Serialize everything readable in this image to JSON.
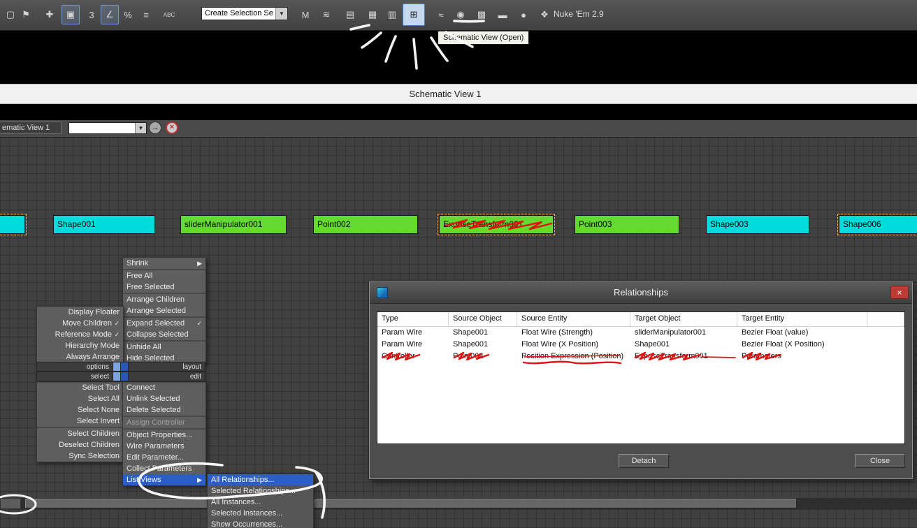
{
  "glyphs": {
    "submenu_arrow": "▶",
    "check": "✓",
    "dropdown_arrow": "▼",
    "find_arrow": "→",
    "cancel_x": "×",
    "close_x": "×"
  },
  "colors": {
    "node_shape": "#00dcdc",
    "node_helper": "#63d932",
    "menu_highlight": "#2d5ec6",
    "toolbar_highlight_border": "#4d7fc0",
    "annotation_white": "#ffffff",
    "annotation_red": "#e01212"
  },
  "toolbar": {
    "icons": [
      {
        "name": "new-scene-icon",
        "glyph": "▢"
      },
      {
        "name": "select-and-place-icon",
        "glyph": "⚑"
      },
      {
        "name": "select-and-move-icon",
        "glyph": "✚"
      },
      {
        "name": "select-and-manipulate-icon",
        "glyph": "▣"
      },
      {
        "name": "angle-snap-icon",
        "glyph": "3"
      },
      {
        "name": "snaps-toggle-icon",
        "glyph": "∠"
      },
      {
        "name": "percent-snap-icon",
        "glyph": "%"
      },
      {
        "name": "spinner-snap-icon",
        "glyph": "≡"
      },
      {
        "name": "named-selection-sets-icon",
        "glyph": "ABC"
      },
      {
        "name": "mirror-icon",
        "glyph": "M"
      },
      {
        "name": "align-icon",
        "glyph": "≋"
      },
      {
        "name": "layer-manager-icon",
        "glyph": "▤"
      },
      {
        "name": "graphite-ribbon-icon",
        "glyph": "▦"
      },
      {
        "name": "scene-explorer-icon",
        "glyph": "▥"
      },
      {
        "name": "schematic-view-icon",
        "glyph": "⊞"
      },
      {
        "name": "curve-editor-icon",
        "glyph": "≈"
      },
      {
        "name": "material-editor-icon",
        "glyph": "◉"
      },
      {
        "name": "render-setup-icon",
        "glyph": "▩"
      },
      {
        "name": "rendered-frame-icon",
        "glyph": "▬"
      },
      {
        "name": "render-production-icon",
        "glyph": "●"
      },
      {
        "name": "nukem-plugin-icon",
        "glyph": "❖"
      }
    ],
    "selection_set_value": "Create Selection Se",
    "plugin_label": "Nuke 'Em 2.9",
    "tooltip": "Schematic View (Open)"
  },
  "window": {
    "title": "Schematic View 1"
  },
  "sv_toolbar": {
    "view_label": "ematic View 1",
    "search_value": ""
  },
  "canvas": {
    "nodes": [
      {
        "label": "",
        "type": "shape",
        "selected": true
      },
      {
        "label": "Shape001",
        "type": "shape",
        "selected": false
      },
      {
        "label": "sliderManipulator001",
        "type": "helper",
        "selected": false
      },
      {
        "label": "Point002",
        "type": "helper",
        "selected": false
      },
      {
        "label": "ExposeTransform001",
        "type": "helper",
        "selected": true
      },
      {
        "label": "Point003",
        "type": "helper",
        "selected": false
      },
      {
        "label": "Shape003",
        "type": "shape",
        "selected": false
      },
      {
        "label": "Shape006",
        "type": "shape",
        "selected": true
      }
    ]
  },
  "quad_menu": {
    "layout_items": [
      {
        "label": "Shrink",
        "arrow": true
      },
      {
        "label": "Free All"
      },
      {
        "label": "Free Selected"
      },
      {
        "label": "Arrange Children"
      },
      {
        "label": "Arrange Selected"
      },
      {
        "label": "Expand Selected",
        "checked": true
      },
      {
        "label": "Collapse Selected"
      },
      {
        "label": "Unhide All"
      },
      {
        "label": "Hide Selected"
      }
    ],
    "options_items": [
      {
        "label": "Display Floater"
      },
      {
        "label": "Move Children",
        "checked": true
      },
      {
        "label": "Reference Mode",
        "checked": true
      },
      {
        "label": "Hierarchy Mode"
      },
      {
        "label": "Always Arrange"
      }
    ],
    "headers": [
      {
        "left": "options",
        "right": "layout"
      },
      {
        "left": "select",
        "right": "edit"
      }
    ],
    "select_items": [
      {
        "label": "Select Tool"
      },
      {
        "label": "Select All"
      },
      {
        "label": "Select None"
      },
      {
        "label": "Select Invert"
      },
      {
        "label": "Select Children"
      },
      {
        "label": "Deselect Children"
      },
      {
        "label": "Sync Selection"
      }
    ],
    "edit_items": [
      {
        "label": "Connect"
      },
      {
        "label": "Unlink Selected"
      },
      {
        "label": "Delete Selected"
      },
      {
        "label": "Assign Controller",
        "disabled": true
      },
      {
        "label": "Object Properties..."
      },
      {
        "label": "Wire Parameters"
      },
      {
        "label": "Edit Parameter..."
      },
      {
        "label": "Collect Parameters"
      },
      {
        "label": "List Views",
        "arrow": true,
        "highlighted": true
      }
    ],
    "list_views_submenu": [
      {
        "label": "All Relationships...",
        "highlighted": true
      },
      {
        "label": "Selected Relationships..."
      },
      {
        "label": "All Instances..."
      },
      {
        "label": "Selected Instances..."
      },
      {
        "label": "Show Occurrences..."
      }
    ]
  },
  "relationships_dialog": {
    "title": "Relationships",
    "columns": [
      "Type",
      "Source Object",
      "Source Entity",
      "Target Object",
      "Target Entity"
    ],
    "rows": [
      [
        "Param Wire",
        "Shape001",
        "Float Wire (Strength)",
        "sliderManipulator001",
        "Bezier Float (value)"
      ],
      [
        "Param Wire",
        "Shape001",
        "Float Wire (X Position)",
        "Shape001",
        "Bezier Float (X Position)"
      ],
      [
        "Controller",
        "Point002",
        "Position Expression (Position)",
        "ExposeTransform001",
        "Parameters"
      ]
    ],
    "detach_label": "Detach",
    "close_label": "Close"
  }
}
